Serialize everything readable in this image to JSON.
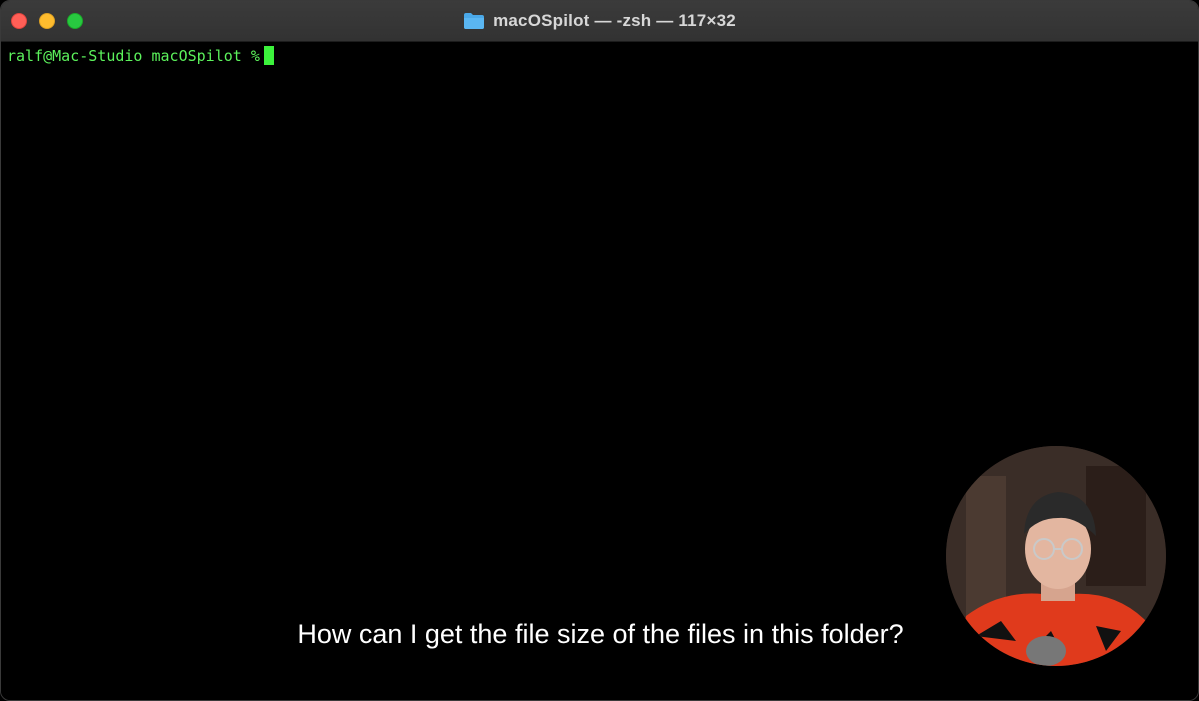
{
  "window": {
    "title": "macOSpilot — -zsh — 117×32",
    "title_icon": "folder-icon"
  },
  "terminal": {
    "prompt": "ralf@Mac-Studio macOSpilot %",
    "prompt_color": "#5cf25c",
    "background": "#000000"
  },
  "caption": {
    "text": "How can I get the file size of the files in this folder?"
  },
  "colors": {
    "close": "#ff5f57",
    "minimize": "#febc2e",
    "zoom": "#28c840",
    "folder": "#4aa8e8"
  }
}
